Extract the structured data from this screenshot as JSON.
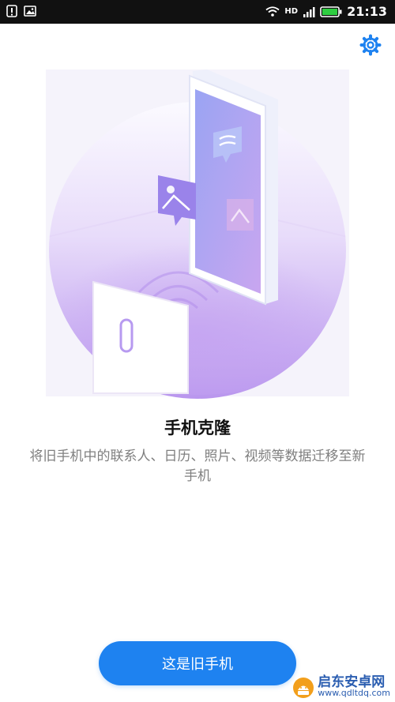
{
  "status_bar": {
    "time": "21:13",
    "network": "HD",
    "icons": [
      "notification-icon",
      "image-icon",
      "wifi-icon",
      "signal-icon",
      "battery-icon"
    ],
    "battery_color": "#2ecc40"
  },
  "toolbar": {
    "settings_icon": "gear-icon",
    "accent_color": "#1e82f0"
  },
  "hero": {
    "illustration": "phone-clone-illustration"
  },
  "main": {
    "title": "手机克隆",
    "description": "将旧手机中的联系人、日历、照片、视频等数据迁移至新手机"
  },
  "actions": {
    "old_phone_button": "这是旧手机"
  },
  "watermark": {
    "name": "启东安卓网",
    "url": "www.qdltdq.com"
  }
}
